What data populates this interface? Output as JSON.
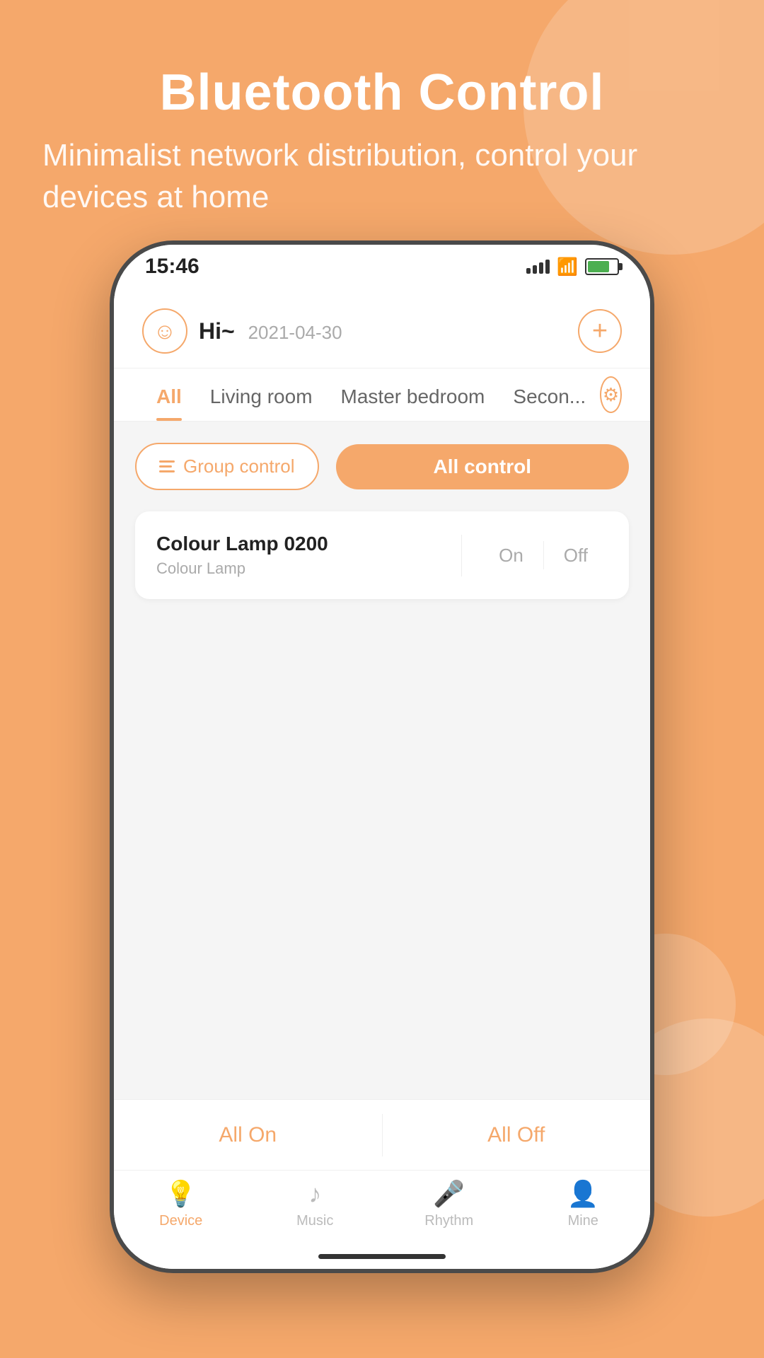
{
  "background": {
    "color": "#F5A86B"
  },
  "header": {
    "title": "Bluetooth Control",
    "subtitle": "Minimalist network distribution, control your devices at home"
  },
  "status_bar": {
    "time": "15:46"
  },
  "app": {
    "greeting": "Hi~",
    "date": "2021-04-30",
    "tabs": [
      {
        "id": "all",
        "label": "All",
        "active": true
      },
      {
        "id": "living",
        "label": "Living room",
        "active": false
      },
      {
        "id": "master",
        "label": "Master bedroom",
        "active": false
      },
      {
        "id": "second",
        "label": "Secon...",
        "active": false
      }
    ],
    "group_control_label": "Group control",
    "all_control_label": "All control",
    "devices": [
      {
        "id": "device-1",
        "name": "Colour Lamp 0200",
        "type": "Colour Lamp",
        "on_label": "On",
        "off_label": "Off"
      }
    ],
    "all_on_label": "All On",
    "all_off_label": "All Off",
    "nav": [
      {
        "id": "device",
        "label": "Device",
        "icon": "💡",
        "active": true
      },
      {
        "id": "music",
        "label": "Music",
        "icon": "🎵",
        "active": false
      },
      {
        "id": "rhythm",
        "label": "Rhythm",
        "icon": "🎤",
        "active": false
      },
      {
        "id": "mine",
        "label": "Mine",
        "icon": "👤",
        "active": false
      }
    ]
  }
}
